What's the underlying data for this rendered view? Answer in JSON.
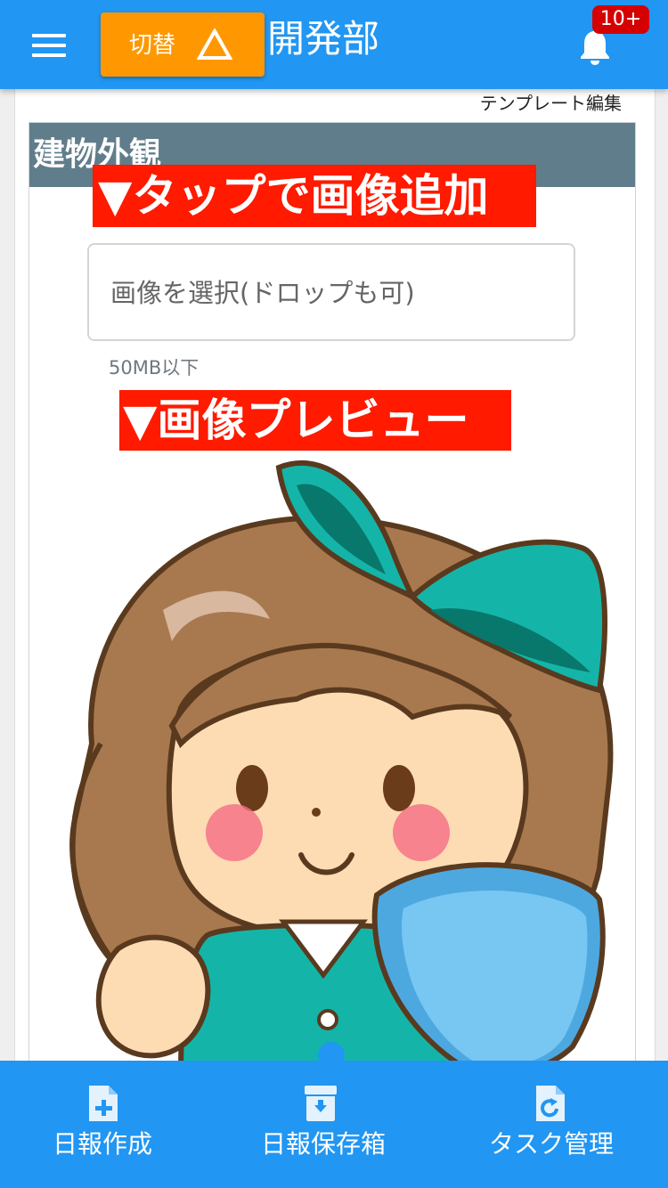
{
  "header": {
    "switch_label": "切替",
    "title": "開発部",
    "badge": "10+"
  },
  "main": {
    "template_edit": "テンプレート編集",
    "section_title": "建物外観",
    "annotation_add": "▼タップで画像追加",
    "file_placeholder": "画像を選択(ドロップも可)",
    "size_note": "50MB以下",
    "annotation_preview": "▼画像プレビュー"
  },
  "bottom_nav": {
    "items": [
      {
        "label": "日報作成",
        "icon": "file-plus-icon"
      },
      {
        "label": "日報保存箱",
        "icon": "archive-box-icon"
      },
      {
        "label": "タスク管理",
        "icon": "file-refresh-icon"
      }
    ]
  },
  "colors": {
    "primary": "#2196f3",
    "switch": "#ff9800",
    "badge": "#d50000",
    "annotation": "#ff1a00",
    "card_header": "#607d8b"
  }
}
